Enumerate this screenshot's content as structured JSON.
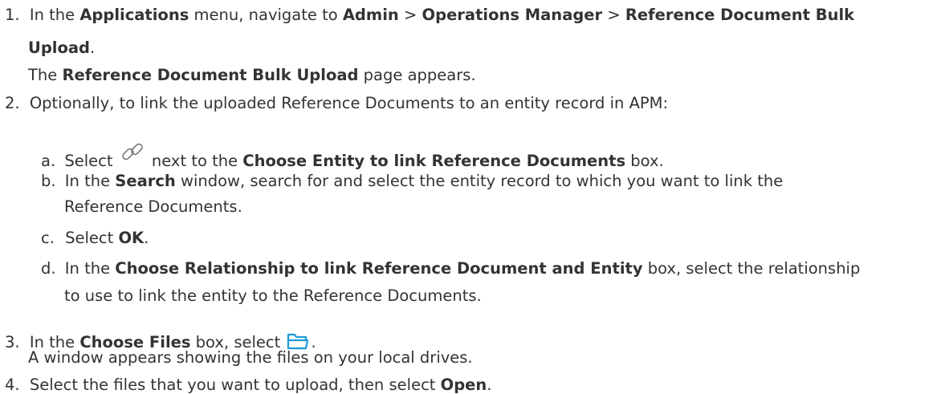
{
  "steps": [
    {
      "number": "1.",
      "seg": [
        "In the ",
        "Applications",
        " menu, navigate to ",
        "Admin",
        " > ",
        "Operations Manager",
        " > ",
        "Reference Document Bulk",
        "Upload",
        "."
      ],
      "result": [
        "The ",
        "Reference Document Bulk Upload",
        " page appears."
      ]
    },
    {
      "number": "2.",
      "text": "Optionally, to link the uploaded Reference Documents to an entity record in APM:",
      "substeps": [
        {
          "letter": "a.",
          "seg": [
            "Select ",
            " next to the ",
            "Choose Entity to link Reference Documents",
            " box."
          ],
          "icon": "link-icon"
        },
        {
          "letter": "b.",
          "seg": [
            "In the ",
            "Search",
            " window, search for and select the entity record to which you want to link the",
            "Reference Documents."
          ]
        },
        {
          "letter": "c.",
          "seg": [
            "Select ",
            "OK",
            "."
          ]
        },
        {
          "letter": "d.",
          "seg": [
            "In the ",
            "Choose Relationship to link Reference Document and Entity",
            " box, select the relationship",
            "to use to link the entity to the Reference Documents."
          ]
        }
      ]
    },
    {
      "number": "3.",
      "seg": [
        "In the ",
        "Choose Files",
        " box, select ",
        "."
      ],
      "icon": "folder-icon",
      "result": "A window appears showing the files on your local drives."
    },
    {
      "number": "4.",
      "seg": [
        "Select the files that you want to upload, then select ",
        "Open",
        "."
      ]
    }
  ],
  "colors": {
    "text": "#333333",
    "folder_icon": "#1e9bd7"
  }
}
